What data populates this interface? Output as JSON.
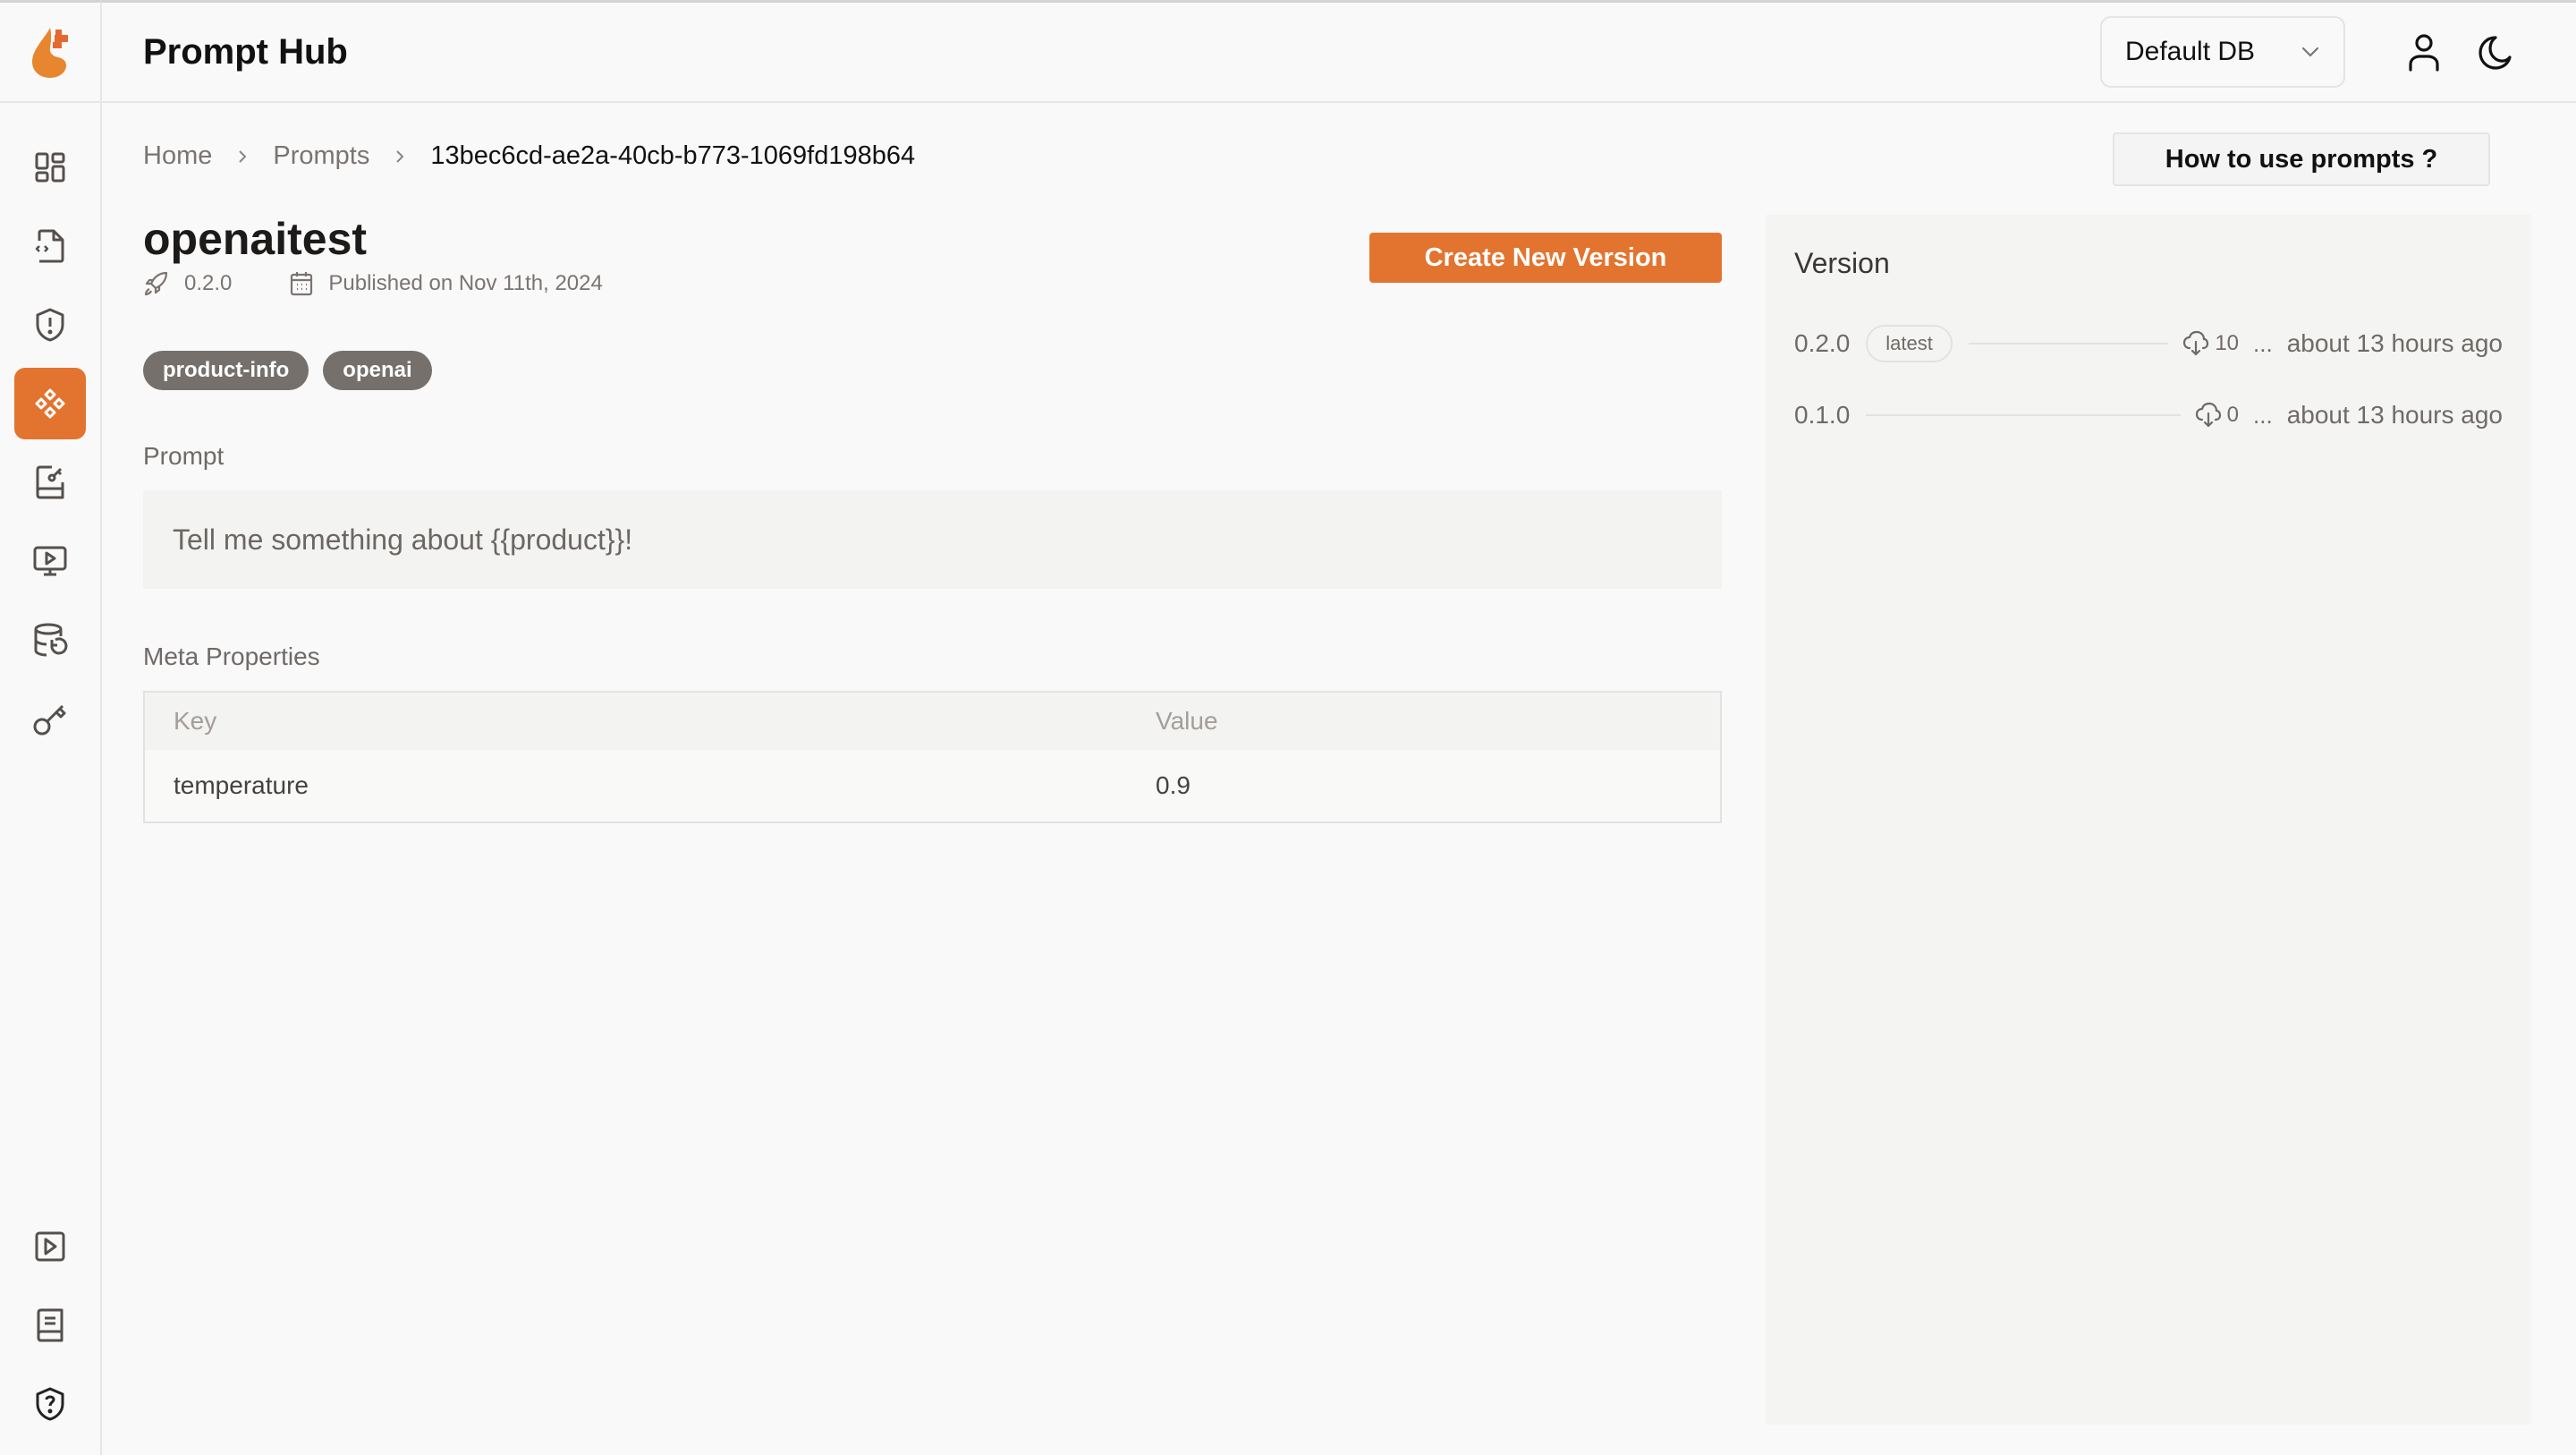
{
  "header": {
    "app_title": "Prompt Hub",
    "db_select": {
      "value": "Default DB"
    },
    "icons": [
      "user-icon",
      "moon-icon"
    ]
  },
  "sidebar": {
    "items": [
      {
        "name": "dashboard",
        "icon": "layout-grid-icon",
        "active": false
      },
      {
        "name": "code-file",
        "icon": "file-code-icon",
        "active": false
      },
      {
        "name": "guard",
        "icon": "shield-alert-icon",
        "active": false
      },
      {
        "name": "prompts",
        "icon": "diamonds-icon",
        "active": true
      },
      {
        "name": "notebook",
        "icon": "book-key-icon",
        "active": false
      },
      {
        "name": "playground",
        "icon": "monitor-play-icon",
        "active": false
      },
      {
        "name": "database",
        "icon": "database-restore-icon",
        "active": false
      },
      {
        "name": "keys",
        "icon": "key-icon",
        "active": false
      }
    ],
    "bottom_items": [
      {
        "name": "tutorials",
        "icon": "play-square-icon"
      },
      {
        "name": "docs",
        "icon": "book-icon"
      },
      {
        "name": "help",
        "icon": "shield-question-icon"
      }
    ]
  },
  "breadcrumb": {
    "items": [
      "Home",
      "Prompts",
      "13bec6cd-ae2a-40cb-b773-1069fd198b64"
    ]
  },
  "howto_button": "How to use prompts ?",
  "prompt": {
    "name": "openaitest",
    "version": "0.2.0",
    "published": "Published on Nov 11th, 2024",
    "create_button": "Create New Version",
    "tags": [
      "product-info",
      "openai"
    ],
    "prompt_label": "Prompt",
    "prompt_text": "Tell me something about {{product}}!",
    "meta_label": "Meta Properties",
    "meta_table": {
      "headers": [
        "Key",
        "Value"
      ],
      "rows": [
        {
          "key": "temperature",
          "value": "0.9"
        }
      ]
    }
  },
  "versions": {
    "title": "Version",
    "items": [
      {
        "version": "0.2.0",
        "badge": "latest",
        "downloads": "10",
        "ellipsis": "...",
        "time": "about 13 hours ago"
      },
      {
        "version": "0.1.0",
        "badge": null,
        "downloads": "0",
        "ellipsis": "...",
        "time": "about 13 hours ago"
      }
    ]
  },
  "colors": {
    "accent": "#e2742f",
    "tag_bg": "#75706c"
  }
}
